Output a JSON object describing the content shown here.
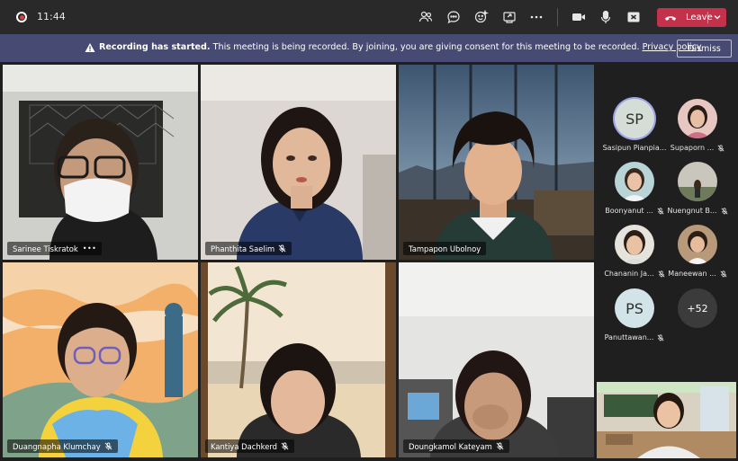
{
  "topbar": {
    "timer": "11:44",
    "leave_label": "Leave",
    "icons": [
      "record-icon",
      "people-icon",
      "chat-icon",
      "reactions-icon",
      "share-icon",
      "more-icon",
      "camera-icon",
      "mic-icon",
      "share-tray-icon",
      "phone-icon",
      "chevron-down-icon"
    ]
  },
  "banner": {
    "title": "Recording has started.",
    "message": "This meeting is being recorded. By joining, you are giving consent for this meeting to be recorded.",
    "link": "Privacy policy",
    "dismiss_label": "Dismiss",
    "color": "#474a72"
  },
  "grid": {
    "tiles": [
      {
        "name": "Sarinee Tiskratok",
        "more": "•••"
      },
      {
        "name": "Phanthita Saelim"
      },
      {
        "name": "Tampapon Ubolnoy"
      },
      {
        "name": "Duangnapha Klumchay"
      },
      {
        "name": "Kantiya Dachkerd"
      },
      {
        "name": "Doungkamol Kateyam"
      }
    ]
  },
  "participants": [
    {
      "initials": "SP",
      "name": "Sasipun Pianpia..."
    },
    {
      "name": "Supaporn ..."
    },
    {
      "name": "Boonyanut ..."
    },
    {
      "name": "Nuengnut B..."
    },
    {
      "name": "Chananin Ja..."
    },
    {
      "name": "Maneewan ..."
    },
    {
      "initials": "PS",
      "name": "Panuttawan..."
    },
    {
      "count": "+52"
    }
  ],
  "colors": {
    "leave": "#c4314b",
    "active_outline": "#a8a6d6",
    "background": "#1f1f1f"
  }
}
